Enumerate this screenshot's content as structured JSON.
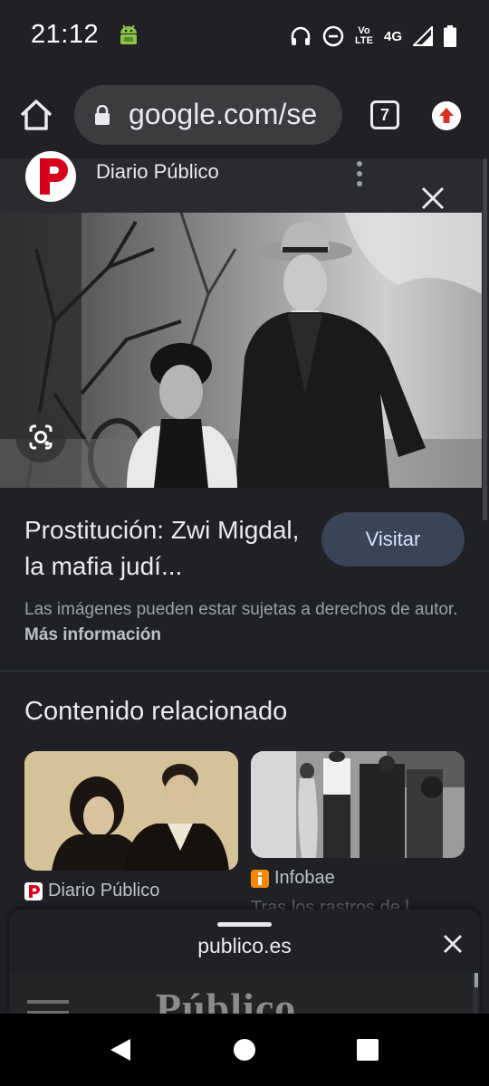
{
  "status_bar": {
    "time": "21:12",
    "volte_line1": "Vo",
    "volte_line2": "LTE",
    "network": "4G"
  },
  "toolbar": {
    "url": "google.com/se",
    "tab_count": "7"
  },
  "source": {
    "name": "Diario Público"
  },
  "result": {
    "title": "Prostitución: Zwi Migdal, la mafia judí...",
    "visit_label": "Visitar",
    "copyright_text": "Las imágenes pueden estar sujetas a derechos de autor.",
    "copyright_link": "Más información"
  },
  "related": {
    "heading": "Contenido relacionado",
    "items": [
      {
        "source": "Diario Público",
        "snippet": ""
      },
      {
        "source": "Infobae",
        "snippet": "Tras los rastros de l"
      }
    ]
  },
  "sheet": {
    "title": "publico.es",
    "preview_logo": "Público"
  },
  "colors": {
    "background": "#202124",
    "visit_button": "#394457",
    "publico_red": "#d6001c",
    "infobae_orange": "#f28a00"
  },
  "icons": [
    "android-debug-icon",
    "headphones-icon",
    "dnd-icon",
    "signal-icon",
    "battery-icon",
    "home-icon",
    "lock-icon",
    "tabs-icon",
    "update-icon",
    "kebab-icon",
    "close-icon",
    "lens-icon",
    "back-icon",
    "nav-home-icon",
    "recents-icon"
  ]
}
